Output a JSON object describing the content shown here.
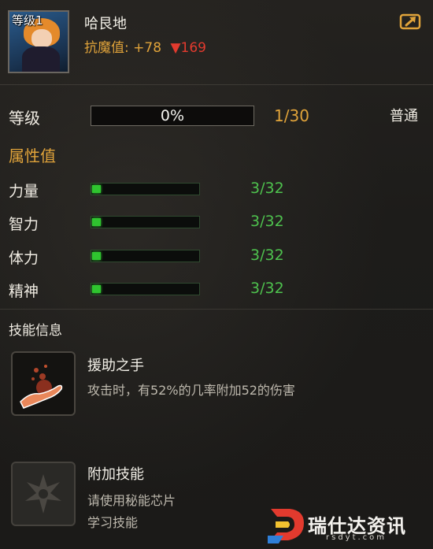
{
  "hero": {
    "level_tag": "等级1",
    "name": "哈艮地",
    "resist_label": "抗魔值:",
    "resist_plus": "+78",
    "resist_arrow": "▼",
    "resist_minus": "169"
  },
  "level": {
    "label": "等级",
    "progress_text": "0%",
    "progress_fraction": 0.0,
    "count": "1/30",
    "rarity": "普通"
  },
  "attributes": {
    "title": "属性值",
    "items": [
      {
        "name": "力量",
        "value": "3/32",
        "fraction": 0.094
      },
      {
        "name": "智力",
        "value": "3/32",
        "fraction": 0.094
      },
      {
        "name": "体力",
        "value": "3/32",
        "fraction": 0.094
      },
      {
        "name": "精神",
        "value": "3/32",
        "fraction": 0.094
      }
    ]
  },
  "skills": {
    "title": "技能信息",
    "items": [
      {
        "name": "援助之手",
        "desc_lines": [
          "攻击时，有52%的几率附加52的伤害"
        ],
        "icon": "helping-hand-icon"
      },
      {
        "name": "附加技能",
        "desc_lines": [
          "请使用秘能芯片",
          "学习技能"
        ],
        "icon": "locked-skill-icon"
      }
    ]
  },
  "watermark": {
    "text": "瑞仕达资讯",
    "url": "rsdyt.com"
  },
  "colors": {
    "gold": "#e0a33a",
    "red": "#e23a2e",
    "green": "#4ec24e",
    "bar_green": "#2fc42f"
  }
}
